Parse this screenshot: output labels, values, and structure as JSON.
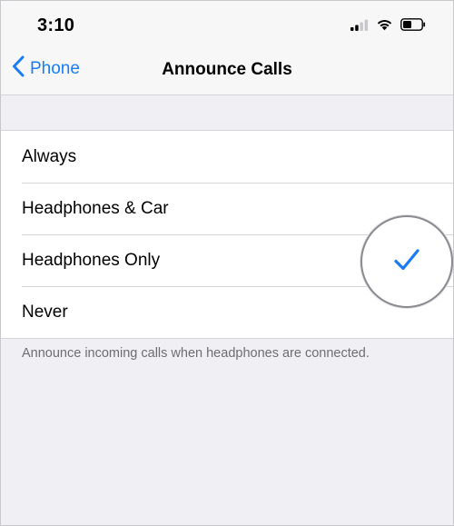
{
  "status_bar": {
    "time": "3:10",
    "icons": [
      "signal-icon",
      "wifi-icon",
      "battery-icon"
    ]
  },
  "nav": {
    "back_label": "Phone",
    "title": "Announce Calls"
  },
  "options": [
    {
      "label": "Always",
      "selected": false
    },
    {
      "label": "Headphones & Car",
      "selected": false
    },
    {
      "label": "Headphones Only",
      "selected": true
    },
    {
      "label": "Never",
      "selected": false
    }
  ],
  "footer_note": "Announce incoming calls when headphones are connected.",
  "colors": {
    "accent": "#1a7cf5",
    "background": "#efeff4",
    "bar": "#f7f7f7",
    "separator": "#d6d6da",
    "secondary_text": "#6d6d72"
  }
}
